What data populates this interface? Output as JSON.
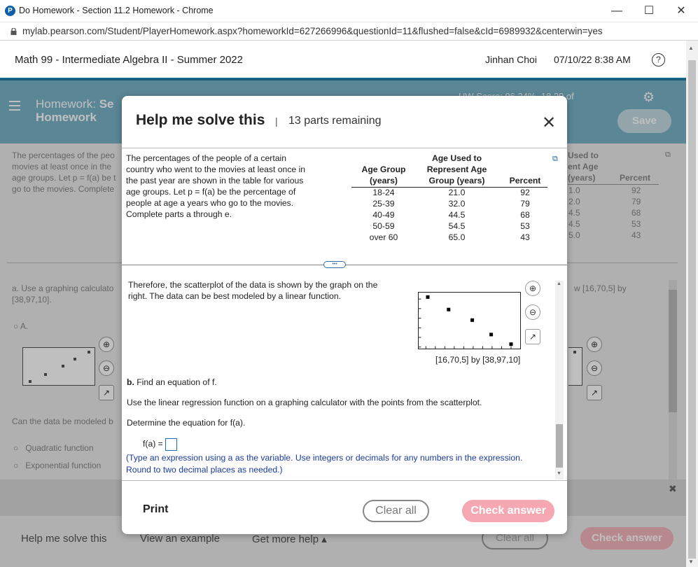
{
  "window": {
    "title": "Do Homework - Section 11.2 Homework - Chrome",
    "logo_letter": "P",
    "url": "mylab.pearson.com/Student/PlayerHomework.aspx?homeworkId=627266996&questionId=11&flushed=false&cId=6989932&centerwin=yes",
    "controls": {
      "minimize": "—",
      "maximize": "☐",
      "close": "✕"
    }
  },
  "course": {
    "title": "Math 99 - Intermediate Algebra II - Summer 2022",
    "user": "Jinhan Choi",
    "datetime": "07/10/22 8:38 AM",
    "help_icon": "?"
  },
  "homework": {
    "label_prefix": "Homework:",
    "label_partial": "Se",
    "label_line2": "Homework",
    "score": "HW Score: 96.24%, 18.29 of",
    "save_label": "Save"
  },
  "background": {
    "q_lines": [
      "The percentages of the peo",
      "movies at least once in the",
      "age groups. Let p = f(a) be t",
      "go to the movies. Complete"
    ],
    "right_header": [
      "Used to",
      "ent Age",
      "(years)"
    ],
    "right_percent_header": "Percent",
    "right_ages": [
      "1.0",
      "2.0",
      "4.5",
      "4.5",
      "5.0"
    ],
    "right_percents": [
      "92",
      "79",
      "68",
      "53",
      "43"
    ],
    "part_a": "a. Use a graphing calculato",
    "part_a_line2": "[38,97,10].",
    "window_right": "w [16,70,5] by",
    "option_a": "A.",
    "can_data": "Can the data be modeled b",
    "opt_quadratic": "Quadratic function",
    "opt_exponential": "Exponential function"
  },
  "modal": {
    "title": "Help me solve this",
    "separator": "|",
    "parts_remaining": "13 parts remaining",
    "close_icon": "✕",
    "question_lines": [
      "The percentages of the people of a certain",
      "country who went to the movies at least once in",
      "the past year are shown in the table for various",
      "age groups. Let p = f(a) be the percentage of",
      "people at age a years who go to the movies.",
      "Complete parts a through e."
    ],
    "table": {
      "col1_header": [
        "Age Group",
        "(years)"
      ],
      "col2_header": [
        "Age Used to",
        "Represent Age",
        "Group (years)"
      ],
      "col3_header": [
        "Percent"
      ],
      "rows": [
        {
          "group": "18-24",
          "age": "21.0",
          "percent": "92"
        },
        {
          "group": "25-39",
          "age": "32.0",
          "percent": "79"
        },
        {
          "group": "40-49",
          "age": "44.5",
          "percent": "68"
        },
        {
          "group": "50-59",
          "age": "54.5",
          "percent": "53"
        },
        {
          "group": "over 60",
          "age": "65.0",
          "percent": "43"
        }
      ]
    },
    "expand_handle": "•••",
    "scatter_lines": [
      "Therefore, the scatterplot of the data is shown by the graph on the",
      "right. The data can be best modeled by a linear function."
    ],
    "window_caption": "[16,70,5] by [38,97,10]",
    "part_b_label": "b.",
    "part_b_text": " Find an equation of f.",
    "regression_text": "Use the linear regression function on a graphing calculator with the points from the scatterplot.",
    "determine_text": "Determine the equation for f(a).",
    "answer_label": "f(a) =",
    "instruction_line1": "(Type an expression using a as the variable. Use integers or decimals for any numbers in the expression.",
    "instruction_line2": "Round to two decimal places as needed.)",
    "print_label": "Print",
    "clear_label": "Clear all",
    "check_label": "Check answer"
  },
  "bottom": {
    "help_me": "Help me solve this",
    "view_example": "View an example",
    "get_more_help": "Get more help ▴",
    "clear_all": "Clear all",
    "check_answer": "Check answer",
    "dismiss_icon": "✖"
  },
  "chart_data": {
    "type": "scatter",
    "x": [
      21.0,
      32.0,
      44.5,
      54.5,
      65.0
    ],
    "y": [
      92,
      79,
      68,
      53,
      43
    ],
    "xlim": [
      16,
      70
    ],
    "xscale": 5,
    "ylim": [
      38,
      97
    ],
    "yscale": 10,
    "title": "",
    "xlabel": "",
    "ylabel": ""
  }
}
